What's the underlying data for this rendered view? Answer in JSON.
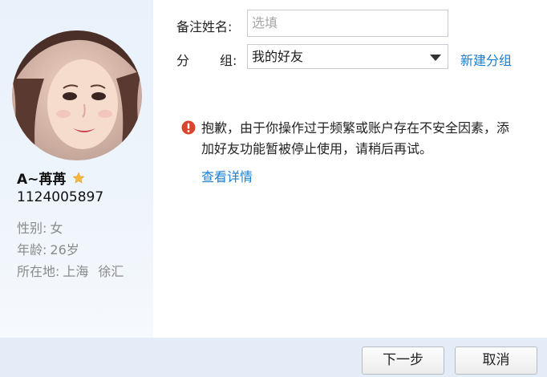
{
  "profile": {
    "nickname": "A~苒苒",
    "qq_number": "1124005897",
    "gender_label": "性别:",
    "gender_value": "女",
    "age_label": "年龄:",
    "age_value": "26岁",
    "location_label": "所在地:",
    "location_city": "上海",
    "location_district": "徐汇"
  },
  "form": {
    "remark_label": "备注姓名:",
    "remark_placeholder": "选填",
    "group_label_1": "分",
    "group_label_2": "组:",
    "group_value": "我的好友",
    "new_group_link": "新建分组"
  },
  "notice": {
    "message": "抱歉，由于你操作过于频繁或账户存在不安全因素，添加好友功能暂被停止使用，请稍后再试。",
    "details_link": "查看详情"
  },
  "footer": {
    "next_button": "下一步",
    "cancel_button": "取消"
  },
  "colors": {
    "link": "#1b7fd0",
    "warning": "#d9452d",
    "star": "#f5b73b"
  }
}
